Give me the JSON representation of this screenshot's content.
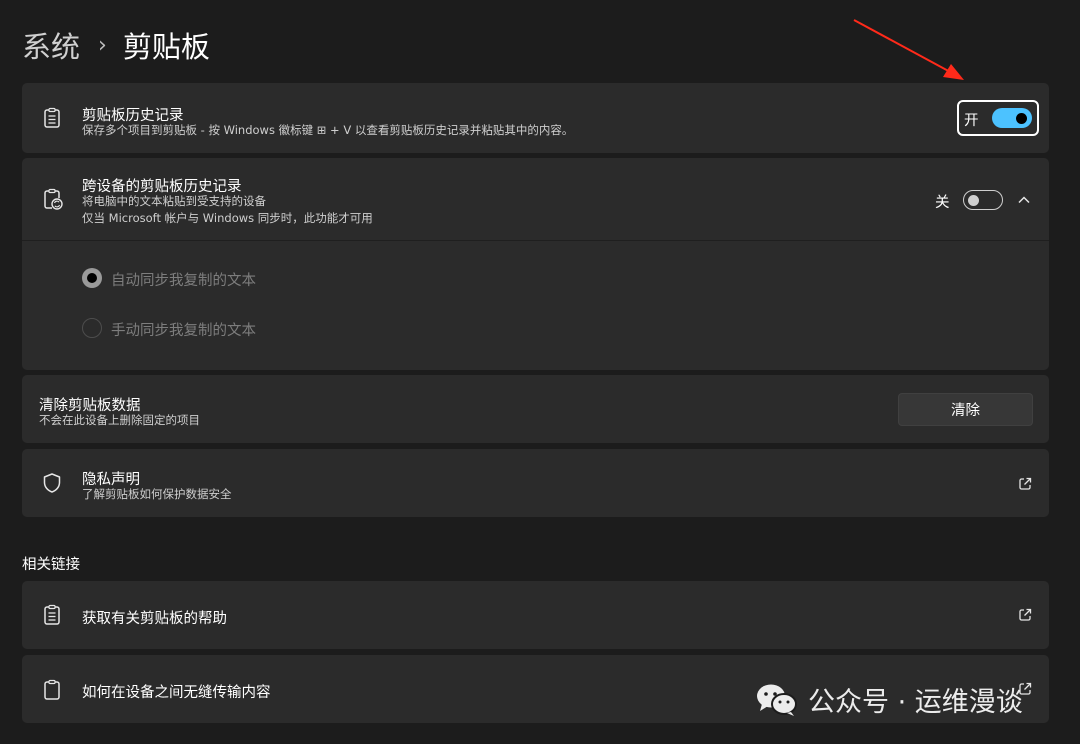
{
  "breadcrumb": {
    "parent": "系统",
    "separator": "›",
    "current": "剪贴板"
  },
  "clipboard_history": {
    "title": "剪贴板历史记录",
    "desc": "保存多个项目到剪贴板 - 按 Windows 徽标键 ⊞ + V 以查看剪贴板历史记录并粘贴其中的内容。",
    "toggle_label": "开",
    "enabled": true,
    "icon": "clipboard-list-icon"
  },
  "cross_device": {
    "title": "跨设备的剪贴板历史记录",
    "desc_line1": "将电脑中的文本粘贴到受支持的设备",
    "desc_line2": "仅当 Microsoft 帐户与 Windows 同步时，此功能才可用",
    "toggle_label": "关",
    "enabled": false,
    "expanded": true,
    "icon": "clipboard-sync-icon",
    "options": [
      {
        "label": "自动同步我复制的文本",
        "checked": true
      },
      {
        "label": "手动同步我复制的文本",
        "checked": false
      }
    ]
  },
  "clear_data": {
    "title": "清除剪贴板数据",
    "desc": "不会在此设备上删除固定的项目",
    "button_label": "清除"
  },
  "privacy": {
    "title": "隐私声明",
    "desc": "了解剪贴板如何保护数据安全",
    "icon": "shield-icon"
  },
  "related": {
    "heading": "相关链接",
    "items": [
      {
        "label": "获取有关剪贴板的帮助",
        "icon": "clipboard-list-icon"
      },
      {
        "label": "如何在设备之间无缝传输内容",
        "icon": "clipboard-icon"
      }
    ]
  },
  "watermark": {
    "text": "公众号 · 运维漫谈",
    "icon": "wechat-icon"
  },
  "colors": {
    "accent": "#4cc2ff",
    "background": "#1c1c1c",
    "card": "#2b2b2b",
    "annotation_arrow": "#ff2a1a"
  }
}
